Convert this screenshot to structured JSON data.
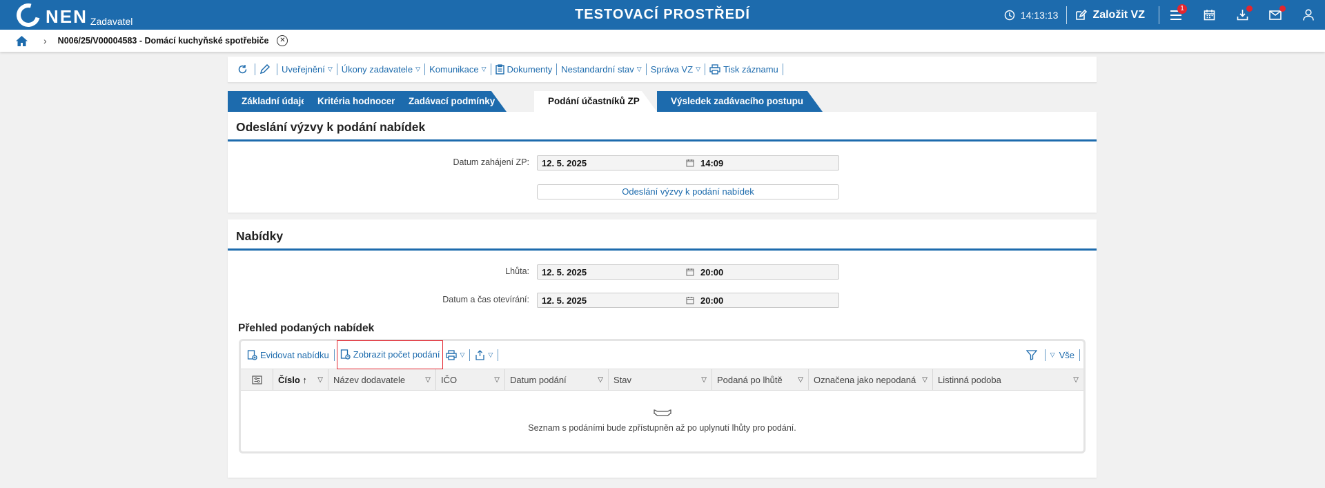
{
  "header": {
    "logo_text": "NEN",
    "logo_sub": "Zadavatel",
    "environment": "TESTOVACÍ PROSTŘEDÍ",
    "clock": "14:13:13",
    "create_label": "Založit VZ",
    "menu_badge": "1"
  },
  "breadcrumb": {
    "record": "N006/25/V00004583 - Domácí kuchyňské spotřebiče"
  },
  "actions": {
    "publish": "Uveřejnění",
    "contracting_acts": "Úkony zadavatele",
    "communication": "Komunikace",
    "documents": "Dokumenty",
    "nonstandard": "Nestandardní stav",
    "management": "Správa VZ",
    "print": "Tisk záznamu"
  },
  "tabs": [
    {
      "label": "Základní údaje"
    },
    {
      "label": "Kritéria hodnocení"
    },
    {
      "label": "Zadávací podmínky"
    },
    {
      "label": "Podání účastníků ZP"
    },
    {
      "label": "Výsledek zadávacího postupu"
    }
  ],
  "invitation": {
    "title": "Odeslání výzvy k podání nabídek",
    "start_label": "Datum zahájení ZP:",
    "start_date": "12. 5. 2025",
    "start_time": "14:09",
    "send_button": "Odeslání výzvy k podání nabídek"
  },
  "offers": {
    "title": "Nabídky",
    "deadline_label": "Lhůta:",
    "deadline_date": "12. 5. 2025",
    "deadline_time": "20:00",
    "opening_label": "Datum a čas otevírání:",
    "opening_date": "12. 5. 2025",
    "opening_time": "20:00",
    "overview_title": "Přehled podaných nabídek",
    "register_button": "Evidovat nabídku",
    "show_count_button": "Zobrazit počet podání",
    "filter_all": "Vše",
    "columns": [
      "Číslo",
      "Název dodavatele",
      "IČO",
      "Datum podání",
      "Stav",
      "Podaná po lhůtě",
      "Označena jako nepodaná",
      "Listinná podoba"
    ],
    "empty_message": "Seznam s podáními bude zpřístupněn až po uplynutí lhůty pro podání."
  }
}
